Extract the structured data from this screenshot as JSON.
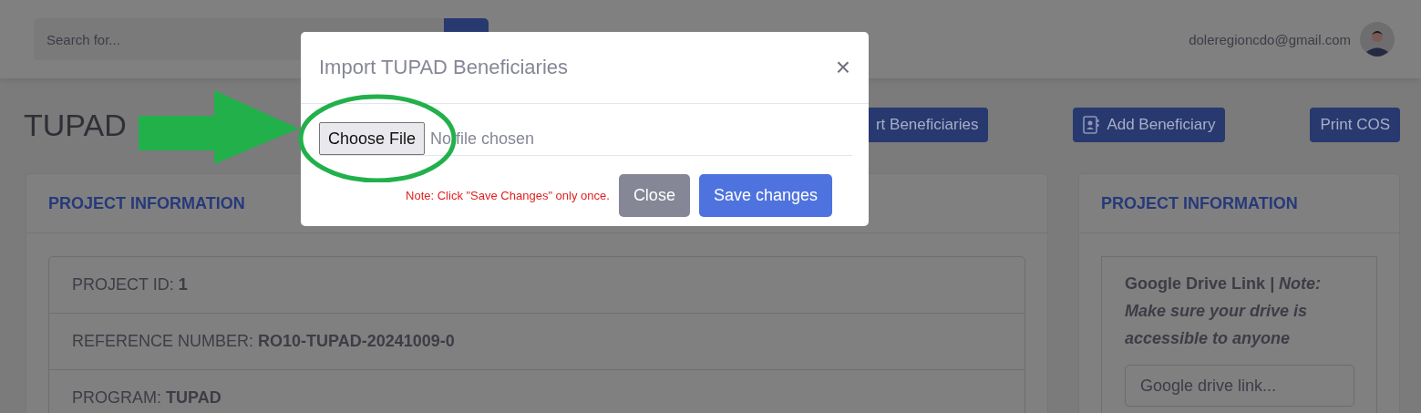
{
  "topbar": {
    "search": {
      "placeholder": "Search for..."
    },
    "user": {
      "email": "doleregioncdo@gmail.com"
    }
  },
  "page": {
    "title": "TUPAD",
    "actions": [
      {
        "label": "rt Beneficiaries",
        "icon": false
      },
      {
        "label": "Add Beneficiary",
        "icon": true
      },
      {
        "label": "Print COS",
        "icon": false
      }
    ]
  },
  "project_card": {
    "header": "PROJECT INFORMATION",
    "rows": [
      {
        "label": "PROJECT ID:",
        "value": "1"
      },
      {
        "label": "REFERENCE NUMBER:",
        "value": "RO10-TUPAD-20241009-0"
      },
      {
        "label": "PROGRAM:",
        "value": "TUPAD"
      }
    ]
  },
  "drive_card": {
    "header": "PROJECT INFORMATION",
    "label": "Google Drive Link *| Note: Make sure your drive is accessible to anyone*",
    "input": {
      "placeholder": "Google drive link..."
    }
  },
  "modal": {
    "title": "Import TUPAD Beneficiaries",
    "close_icon": "×",
    "file_button": "Choose File",
    "file_status": "No file chosen",
    "note": "Note: Click \"Save Changes\" only once.",
    "buttons": [
      {
        "label": "Close",
        "kind": "secondary"
      },
      {
        "label": "Save changes",
        "kind": "primary"
      }
    ]
  }
}
